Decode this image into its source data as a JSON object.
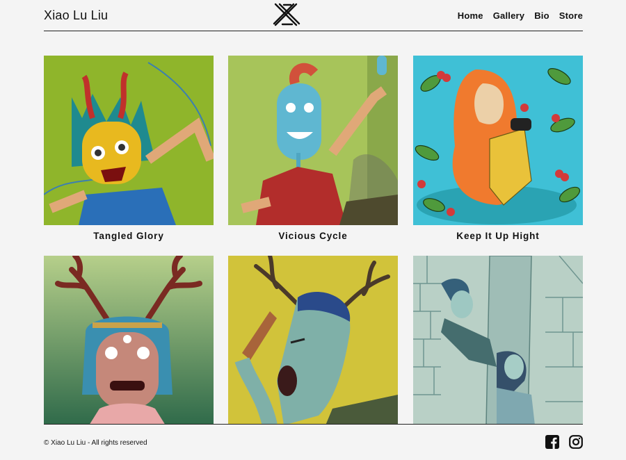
{
  "header": {
    "site_title": "Xiao Lu Liu",
    "logo_icon": "crossed-x-logo-icon",
    "nav": [
      {
        "label": "Home"
      },
      {
        "label": "Gallery"
      },
      {
        "label": "Bio"
      },
      {
        "label": "Store"
      }
    ]
  },
  "gallery": {
    "items": [
      {
        "title": "Tangled Glory"
      },
      {
        "title": "Vicious Cycle"
      },
      {
        "title": "Keep It Up Hight"
      },
      {
        "title": ""
      },
      {
        "title": ""
      },
      {
        "title": ""
      }
    ]
  },
  "footer": {
    "copyright": "© Xiao Lu Liu - All rights reserved",
    "social": [
      {
        "icon": "facebook-icon"
      },
      {
        "icon": "instagram-icon"
      }
    ]
  },
  "colors": {
    "background": "#f4f4f4",
    "text": "#111111",
    "rule": "#222222"
  }
}
